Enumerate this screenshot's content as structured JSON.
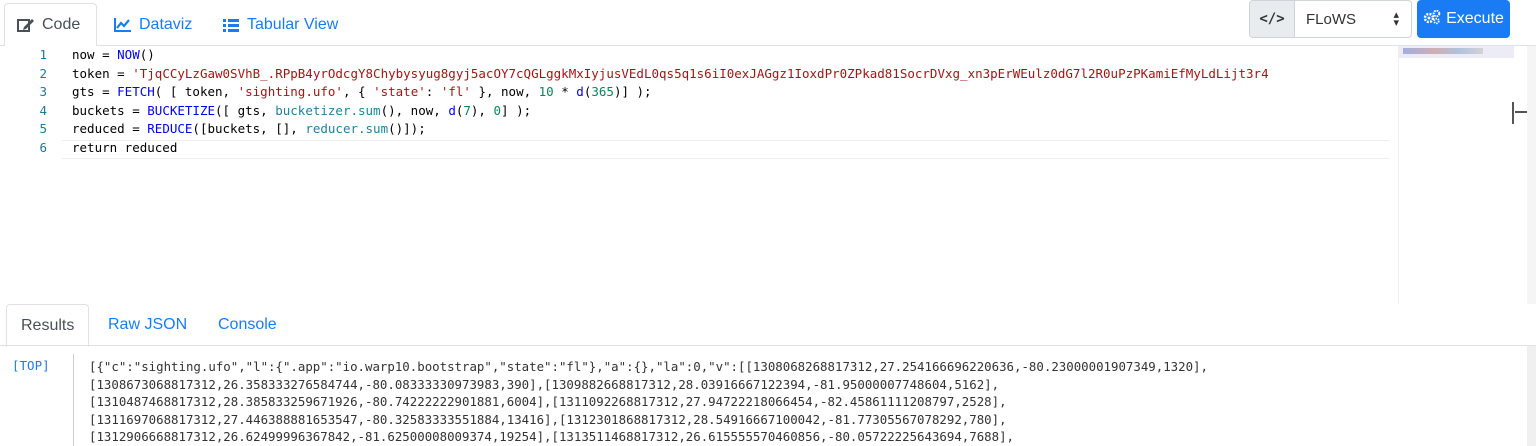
{
  "tabs": {
    "code": "Code",
    "dataviz": "Dataviz",
    "tabular": "Tabular View"
  },
  "toolbar": {
    "code_icon_label": "</>",
    "language": "FLoWS",
    "execute": "Execute"
  },
  "editor": {
    "line_numbers": [
      "1",
      "2",
      "3",
      "4",
      "5",
      "6"
    ],
    "lines": [
      [
        {
          "t": "now = ",
          "c": ""
        },
        {
          "t": "NOW",
          "c": "fn"
        },
        {
          "t": "()",
          "c": ""
        }
      ],
      [
        {
          "t": "token = ",
          "c": ""
        },
        {
          "t": "'TjqCCyLzGaw0SVhB_.RPpB4yrOdcgY8Chybysyug8gyj5acOY7cQGLggkMxIyjusVEdL0qs5q1s6iI0exJAGgz1IoxdPr0ZPkad81SocrDVxg_xn3pErWEulz0dG7l2R0uPzPKamiEfMyLdLijt3r4",
          "c": "str"
        }
      ],
      [
        {
          "t": "gts = ",
          "c": ""
        },
        {
          "t": "FETCH",
          "c": "fn"
        },
        {
          "t": "( [ token, ",
          "c": ""
        },
        {
          "t": "'sighting.ufo'",
          "c": "str"
        },
        {
          "t": ", { ",
          "c": ""
        },
        {
          "t": "'state'",
          "c": "str"
        },
        {
          "t": ": ",
          "c": ""
        },
        {
          "t": "'fl'",
          "c": "str"
        },
        {
          "t": " }, now, ",
          "c": ""
        },
        {
          "t": "10",
          "c": "num"
        },
        {
          "t": " * ",
          "c": ""
        },
        {
          "t": "d",
          "c": "fn"
        },
        {
          "t": "(",
          "c": ""
        },
        {
          "t": "365",
          "c": "num"
        },
        {
          "t": ")] );",
          "c": ""
        }
      ],
      [
        {
          "t": "buckets = ",
          "c": ""
        },
        {
          "t": "BUCKETIZE",
          "c": "fn"
        },
        {
          "t": "([ gts, ",
          "c": ""
        },
        {
          "t": "bucketizer.sum",
          "c": "id"
        },
        {
          "t": "(), now, ",
          "c": ""
        },
        {
          "t": "d",
          "c": "fn"
        },
        {
          "t": "(",
          "c": ""
        },
        {
          "t": "7",
          "c": "num"
        },
        {
          "t": "), ",
          "c": ""
        },
        {
          "t": "0",
          "c": "num"
        },
        {
          "t": "] );",
          "c": ""
        }
      ],
      [
        {
          "t": "reduced = ",
          "c": ""
        },
        {
          "t": "REDUCE",
          "c": "fn"
        },
        {
          "t": "([buckets, [], ",
          "c": ""
        },
        {
          "t": "reducer.sum",
          "c": "id"
        },
        {
          "t": "()]);",
          "c": ""
        }
      ],
      [
        {
          "t": "return reduced",
          "c": ""
        }
      ]
    ]
  },
  "results": {
    "tabs": {
      "results": "Results",
      "raw_json": "Raw JSON",
      "console": "Console"
    },
    "stack_level": "[TOP]",
    "lines": [
      "[{\"c\":\"sighting.ufo\",\"l\":{\".app\":\"io.warp10.bootstrap\",\"state\":\"fl\"},\"a\":{},\"la\":0,\"v\":[[1308068268817312,27.254166696220636,-80.23000001907349,1320],",
      "[1308673068817312,26.358333276584744,-80.08333330973983,390],[1309882668817312,28.03916667122394,-81.95000007748604,5162],",
      "[1310487468817312,28.385833259671926,-80.74222222901881,6004],[1311092268817312,27.94722218066454,-82.45861111208797,2528],",
      "[1311697068817312,27.446388881653547,-80.32583333551884,13416],[1312301868817312,28.54916667100042,-81.77305567078292,780],",
      "[1312906668817312,26.62499996367842,-81.62500008009374,19254],[1313511468817312,26.615555570460856,-80.05722225643694,7688],"
    ]
  },
  "colors": {
    "accent": "#1a7cf5",
    "keyword": "#0000ff",
    "string": "#a31515",
    "number": "#098658"
  }
}
